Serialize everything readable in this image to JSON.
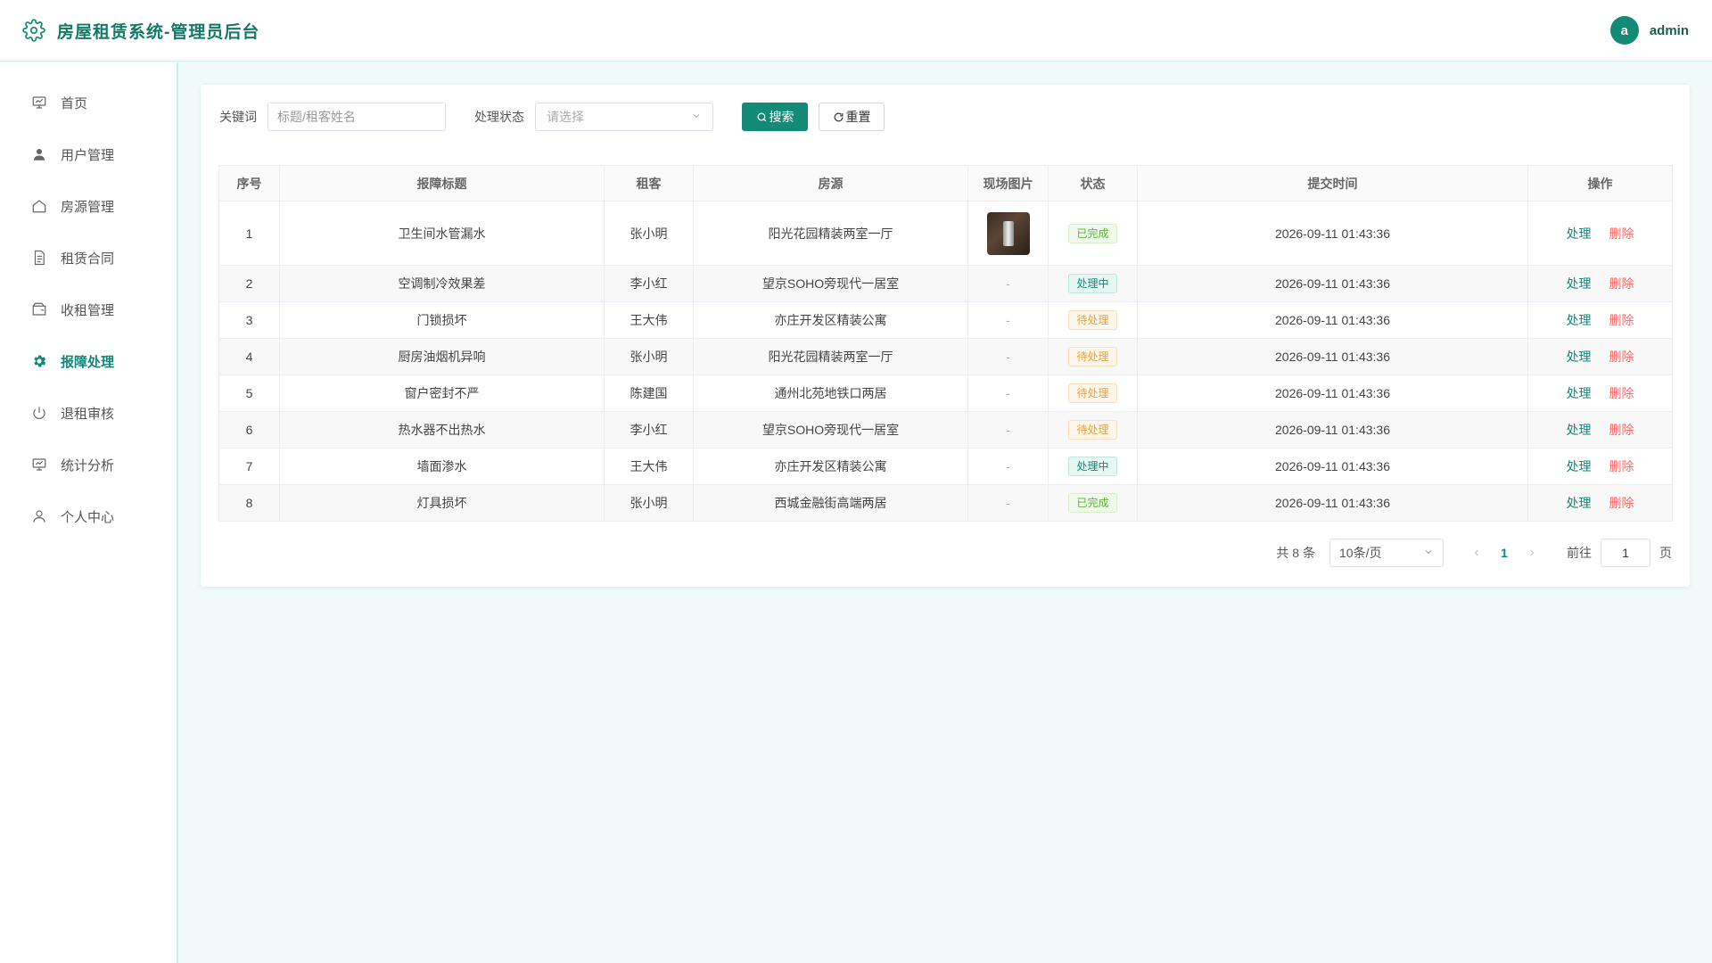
{
  "header": {
    "title": "房屋租赁系统-管理员后台",
    "avatar_letter": "a",
    "username": "admin"
  },
  "sidebar": {
    "items": [
      {
        "label": "首页",
        "icon": "presentation-icon"
      },
      {
        "label": "用户管理",
        "icon": "user-filled-icon"
      },
      {
        "label": "房源管理",
        "icon": "house-icon"
      },
      {
        "label": "租赁合同",
        "icon": "document-icon"
      },
      {
        "label": "收租管理",
        "icon": "wallet-icon"
      },
      {
        "label": "报障处理",
        "icon": "gear-icon"
      },
      {
        "label": "退租审核",
        "icon": "power-icon"
      },
      {
        "label": "统计分析",
        "icon": "chart-board-icon"
      },
      {
        "label": "个人中心",
        "icon": "user-icon"
      }
    ],
    "active_index": 5
  },
  "filters": {
    "keyword_label": "关键词",
    "keyword_placeholder": "标题/租客姓名",
    "status_label": "处理状态",
    "status_placeholder": "请选择",
    "search_label": "搜索",
    "reset_label": "重置"
  },
  "table": {
    "columns": [
      "序号",
      "报障标题",
      "租客",
      "房源",
      "现场图片",
      "状态",
      "提交时间",
      "操作"
    ],
    "rows": [
      {
        "no": "1",
        "title": "卫生间水管漏水",
        "tenant": "张小明",
        "house": "阳光花园精装两室一厅",
        "image": "photo",
        "status": "已完成",
        "status_type": "done",
        "time": "2026-09-11 01:43:36"
      },
      {
        "no": "2",
        "title": "空调制冷效果差",
        "tenant": "李小红",
        "house": "望京SOHO旁现代一居室",
        "image": "-",
        "status": "处理中",
        "status_type": "doing",
        "time": "2026-09-11 01:43:36"
      },
      {
        "no": "3",
        "title": "门锁损坏",
        "tenant": "王大伟",
        "house": "亦庄开发区精装公寓",
        "image": "-",
        "status": "待处理",
        "status_type": "pending",
        "time": "2026-09-11 01:43:36"
      },
      {
        "no": "4",
        "title": "厨房油烟机异响",
        "tenant": "张小明",
        "house": "阳光花园精装两室一厅",
        "image": "-",
        "status": "待处理",
        "status_type": "pending",
        "time": "2026-09-11 01:43:36"
      },
      {
        "no": "5",
        "title": "窗户密封不严",
        "tenant": "陈建国",
        "house": "通州北苑地铁口两居",
        "image": "-",
        "status": "待处理",
        "status_type": "pending",
        "time": "2026-09-11 01:43:36"
      },
      {
        "no": "6",
        "title": "热水器不出热水",
        "tenant": "李小红",
        "house": "望京SOHO旁现代一居室",
        "image": "-",
        "status": "待处理",
        "status_type": "pending",
        "time": "2026-09-11 01:43:36"
      },
      {
        "no": "7",
        "title": "墙面渗水",
        "tenant": "王大伟",
        "house": "亦庄开发区精装公寓",
        "image": "-",
        "status": "处理中",
        "status_type": "doing",
        "time": "2026-09-11 01:43:36"
      },
      {
        "no": "8",
        "title": "灯具损坏",
        "tenant": "张小明",
        "house": "西城金融街高端两居",
        "image": "-",
        "status": "已完成",
        "status_type": "done",
        "time": "2026-09-11 01:43:36"
      }
    ],
    "action_handle": "处理",
    "action_delete": "删除"
  },
  "pagination": {
    "total_text": "共 8 条",
    "page_size": "10条/页",
    "current_page": "1",
    "goto_label": "前往",
    "goto_value": "1",
    "page_unit": "页"
  },
  "colors": {
    "primary": "#138a75",
    "danger": "#f56c6c",
    "success": "#5bb33a",
    "warning": "#e6a23c"
  }
}
